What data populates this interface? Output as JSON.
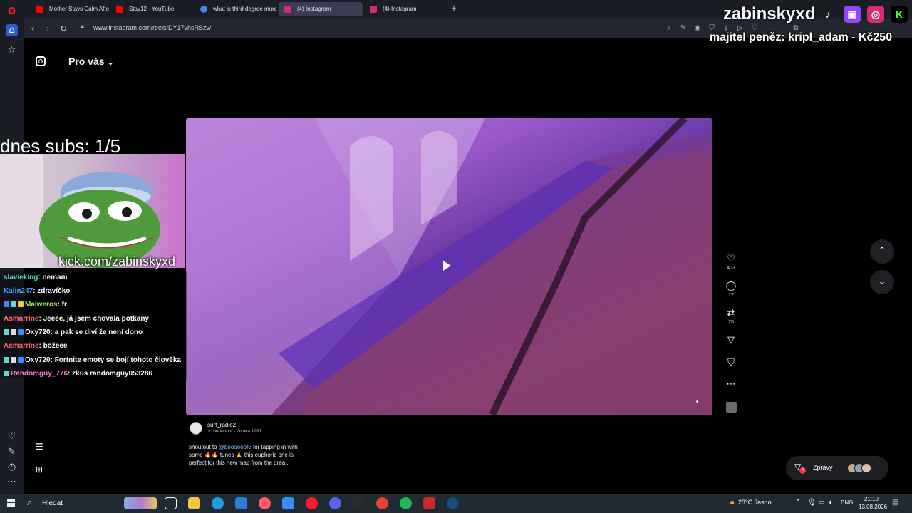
{
  "browser": {
    "tabs": [
      {
        "label": "Mother Stays Calm After S",
        "favicon_color": "#ff0000"
      },
      {
        "label": "Stay12 - YouTube",
        "favicon_color": "#ff0000"
      },
      {
        "label": "what is third degree murd",
        "favicon_color": "#4285f4"
      },
      {
        "label": "(4) Instagram",
        "favicon_color": "#d62976"
      },
      {
        "label": "(4) Instagram",
        "favicon_color": "#d62976"
      }
    ],
    "url": "www.instagram.com/reels/DY17vhsRSzv/"
  },
  "instagram": {
    "feed_title": "Pro vás",
    "feed_chevron": "⌄",
    "actions": {
      "likes": "403",
      "comments": "17",
      "reposts": "25"
    },
    "author": "surf_radio2",
    "audio": "♬ boooooof · Osaka 1997",
    "caption": {
      "prefix": "shoutout to ",
      "mention": "@boooooofe",
      "suffix": " for tapping in with some 🔥🔥 tunes 🙏 this euphoric one is perfect for this new map from the drea..."
    },
    "messages_label": "Zprávy",
    "messages_badge": "4"
  },
  "overlay": {
    "subs_goal": "dnes subs: 1/5",
    "kick_link": "kick.com/zabinskyxd",
    "streamer": "zabinskyxd",
    "owner_text": "majitel peněz: kripl_adam - Kč250",
    "chat": [
      {
        "user": "slavieking",
        "user_color": "#5fd8d0",
        "msg": ": nemam"
      },
      {
        "user": "Kalin247",
        "user_color": "#3aa0ff",
        "msg": ": zdravíčko"
      },
      {
        "user": "Malweros",
        "user_color": "#9be35a",
        "msg": ": fr"
      },
      {
        "user": "Asmarrine",
        "user_color": "#ff6a6a",
        "msg": ": Jeeee, já jsem chovala potkany"
      },
      {
        "user": "Oxy720",
        "user_color": "#ffffff",
        "msg": ": a pak se diví že není dono"
      },
      {
        "user": "Asmarrine",
        "user_color": "#ff6a6a",
        "msg": ": božeee"
      },
      {
        "user": "Oxy720",
        "user_color": "#ffffff",
        "msg": ": Fortnite emoty se bojí tohoto člověka"
      },
      {
        "user": "Randomguy_776",
        "user_color": "#ff7ad8",
        "msg": ": zkus randomguy053286"
      }
    ]
  },
  "taskbar": {
    "search_label": "Hledat",
    "weather": "23°C  Jasno",
    "lang": "ENG",
    "time": "21:19",
    "date": "13.08.2026"
  }
}
